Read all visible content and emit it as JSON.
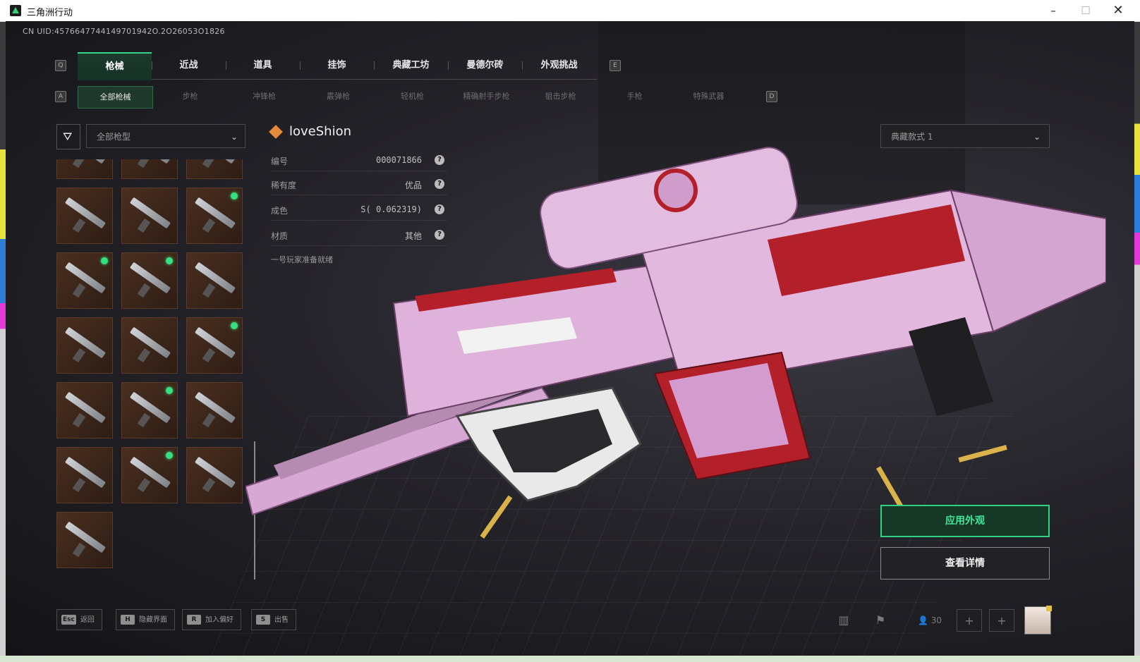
{
  "window": {
    "title": "三角洲行动",
    "minimize": "–",
    "maximize": "☐",
    "close": "✕"
  },
  "uid": "CN UID:4576647744149701942O.2O26053O1826",
  "tabs": [
    "枪械",
    "近战",
    "道具",
    "挂饰",
    "典藏工坊",
    "曼德尔砖",
    "外观挑战"
  ],
  "tab_keys": {
    "left": "Q",
    "right": "E"
  },
  "subtabs": [
    "全部枪械",
    "步枪",
    "冲锋枪",
    "霰弹枪",
    "轻机枪",
    "精确射手步枪",
    "狙击步枪",
    "手枪",
    "特殊武器"
  ],
  "subtab_keys": {
    "left": "A",
    "right": "D"
  },
  "filter": {
    "icon": "filter-icon",
    "select_value": "全部枪型"
  },
  "weapon_cells": [
    {
      "new": false
    },
    {
      "new": false
    },
    {
      "new": false
    },
    {
      "new": false
    },
    {
      "new": false
    },
    {
      "new": true
    },
    {
      "new": true
    },
    {
      "new": true
    },
    {
      "new": false
    },
    {
      "new": false
    },
    {
      "new": false
    },
    {
      "new": true
    },
    {
      "new": false
    },
    {
      "new": true
    },
    {
      "new": false
    },
    {
      "new": false
    },
    {
      "new": true
    },
    {
      "new": false
    },
    {
      "new": false
    }
  ],
  "skin": {
    "name": "loveShion",
    "rows": [
      {
        "label": "编号",
        "value": "000071866"
      },
      {
        "label": "稀有度",
        "value": "优品"
      },
      {
        "label": "成色",
        "value": "S( 0.062319)"
      },
      {
        "label": "材质",
        "value": "其他"
      }
    ],
    "description": "一号玩家准备就绪",
    "help": "?"
  },
  "style_select": "典藏款式 1",
  "buttons": {
    "apply": "应用外观",
    "detail": "查看详情"
  },
  "footer_hints": [
    {
      "key": "Esc",
      "label": "返回"
    },
    {
      "key": "H",
      "label": "隐藏界面"
    },
    {
      "key": "R",
      "label": "加入偏好"
    },
    {
      "key": "S",
      "label": "出售"
    }
  ],
  "bottom_bar": {
    "chart_icon": "▥",
    "flag_icon": "⚑",
    "friends_count": "30",
    "plus": "+"
  },
  "colors": {
    "accent": "#36d48a",
    "cell_bg": "#3b2619",
    "badge": "#35e07e",
    "gun_pink": "#d9a9d6",
    "gun_red": "#b3202a"
  }
}
